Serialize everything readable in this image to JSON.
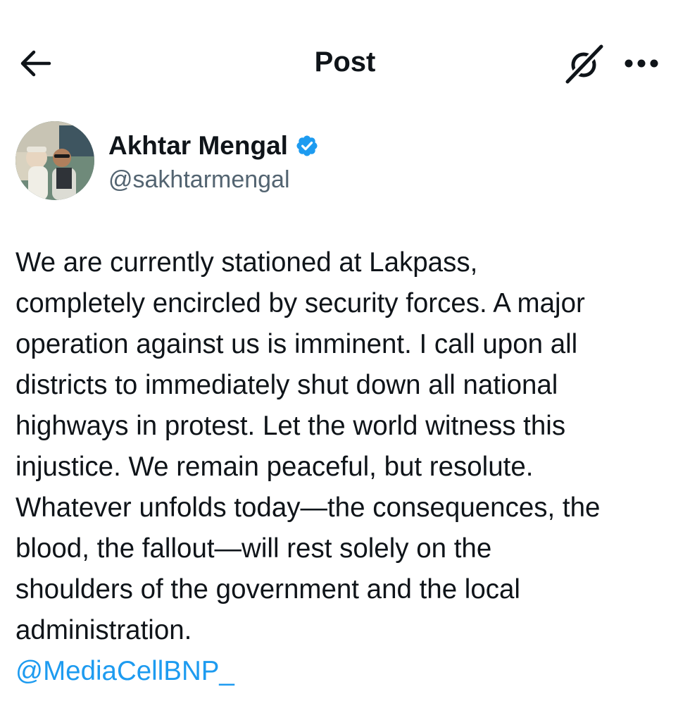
{
  "header": {
    "title": "Post",
    "back_icon": "arrow-left-icon",
    "grok_icon": "grok-icon",
    "more_icon": "more-horizontal-icon"
  },
  "author": {
    "name": "Akhtar Mengal",
    "handle": "@sakhtarmengal",
    "verified": true,
    "verified_icon": "verified-badge-icon",
    "badge_color": "#1d9bf0"
  },
  "post": {
    "text": "We are currently stationed at Lakpass,\ncompletely encircled by security forces. A major\noperation against us is imminent. I call upon all\ndistricts to immediately shut down all national\nhighways in protest. Let the world witness this\ninjustice. We remain peaceful, but resolute.\nWhatever unfolds today—the consequences, the\nblood, the fallout—will rest solely on the\nshoulders of the government and the local\nadministration.",
    "mention": "@MediaCellBNP_"
  },
  "colors": {
    "text": "#0f1419",
    "secondary": "#536471",
    "link": "#1d9bf0",
    "background": "#ffffff"
  }
}
